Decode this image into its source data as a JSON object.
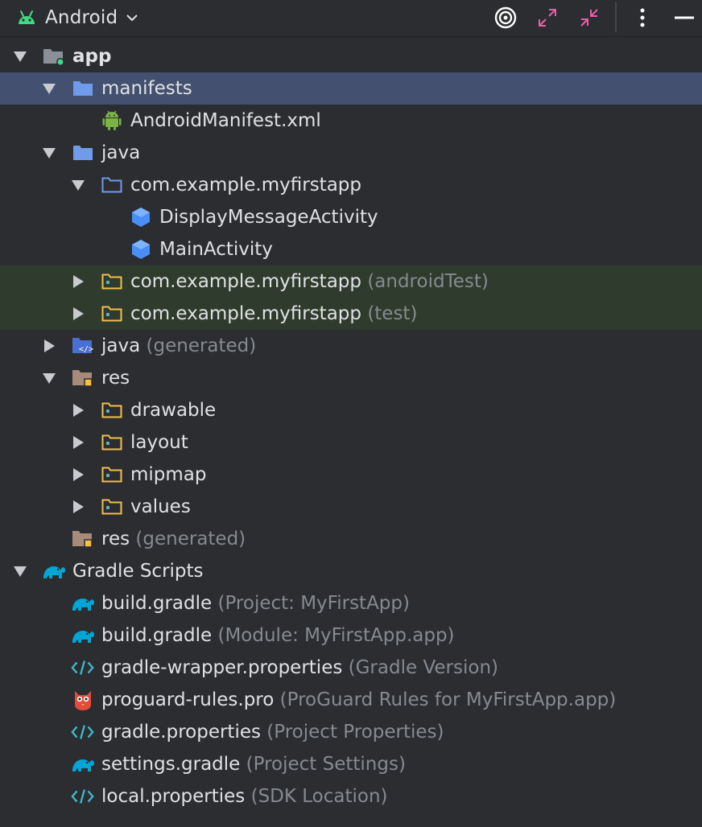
{
  "toolbar": {
    "view_label": "Android",
    "icons": [
      "android-icon",
      "chevron-down-icon",
      "target-icon",
      "expand-icon",
      "collapse-icon",
      "more-options-icon",
      "minimize-icon"
    ]
  },
  "tree": [
    {
      "name": "app",
      "hint": "",
      "level": 0,
      "arrow": "down",
      "icon": "module-folder",
      "bold": true
    },
    {
      "name": "manifests",
      "hint": "",
      "level": 1,
      "arrow": "down",
      "icon": "folder-blue",
      "selected": true
    },
    {
      "name": "AndroidManifest.xml",
      "hint": "",
      "level": 2,
      "arrow": "none",
      "icon": "android"
    },
    {
      "name": "java",
      "hint": "",
      "level": 1,
      "arrow": "down",
      "icon": "folder-blue"
    },
    {
      "name": "com.example.myfirstapp",
      "hint": "",
      "level": 2,
      "arrow": "down",
      "icon": "package-outline"
    },
    {
      "name": "DisplayMessageActivity",
      "hint": "",
      "level": 3,
      "arrow": "none",
      "icon": "class"
    },
    {
      "name": "MainActivity",
      "hint": "",
      "level": 3,
      "arrow": "none",
      "icon": "class"
    },
    {
      "name": "com.example.myfirstapp",
      "hint": "(androidTest)",
      "level": 2,
      "arrow": "right",
      "icon": "folder-yellow",
      "highlight": true
    },
    {
      "name": "com.example.myfirstapp",
      "hint": "(test)",
      "level": 2,
      "arrow": "right",
      "icon": "folder-yellow",
      "highlight": true
    },
    {
      "name": "java",
      "hint": "(generated)",
      "level": 1,
      "arrow": "right",
      "icon": "folder-java-gen"
    },
    {
      "name": "res",
      "hint": "",
      "level": 1,
      "arrow": "down",
      "icon": "folder-res"
    },
    {
      "name": "drawable",
      "hint": "",
      "level": 2,
      "arrow": "right",
      "icon": "folder-yellow"
    },
    {
      "name": "layout",
      "hint": "",
      "level": 2,
      "arrow": "right",
      "icon": "folder-yellow"
    },
    {
      "name": "mipmap",
      "hint": "",
      "level": 2,
      "arrow": "right",
      "icon": "folder-yellow"
    },
    {
      "name": "values",
      "hint": "",
      "level": 2,
      "arrow": "right",
      "icon": "folder-yellow"
    },
    {
      "name": "res",
      "hint": "(generated)",
      "level": 1,
      "arrow": "none",
      "icon": "folder-res"
    },
    {
      "name": "Gradle Scripts",
      "hint": "",
      "level": 0,
      "arrow": "down",
      "icon": "gradle"
    },
    {
      "name": "build.gradle",
      "hint": "(Project: MyFirstApp)",
      "level": 1,
      "arrow": "none",
      "icon": "gradle"
    },
    {
      "name": "build.gradle",
      "hint": "(Module: MyFirstApp.app)",
      "level": 1,
      "arrow": "none",
      "icon": "gradle"
    },
    {
      "name": "gradle-wrapper.properties",
      "hint": "(Gradle Version)",
      "level": 1,
      "arrow": "none",
      "icon": "properties"
    },
    {
      "name": "proguard-rules.pro",
      "hint": "(ProGuard Rules for MyFirstApp.app)",
      "level": 1,
      "arrow": "none",
      "icon": "proguard"
    },
    {
      "name": "gradle.properties",
      "hint": "(Project Properties)",
      "level": 1,
      "arrow": "none",
      "icon": "properties"
    },
    {
      "name": "settings.gradle",
      "hint": "(Project Settings)",
      "level": 1,
      "arrow": "none",
      "icon": "gradle"
    },
    {
      "name": "local.properties",
      "hint": "(SDK Location)",
      "level": 1,
      "arrow": "none",
      "icon": "properties"
    }
  ]
}
